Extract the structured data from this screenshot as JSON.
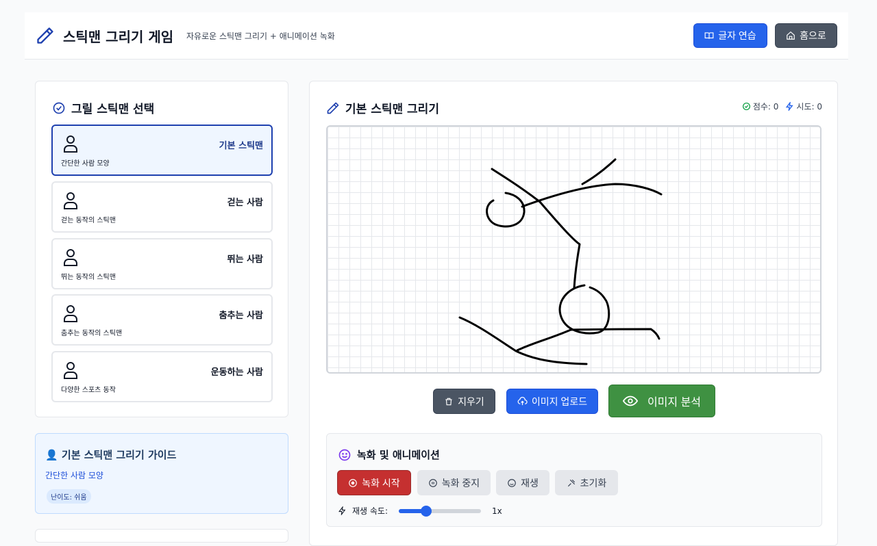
{
  "header": {
    "title": "스틱맨 그리기 게임",
    "subtitle": "자유로운 스틱맨 그리기 + 애니메이션 녹화",
    "practice_button": "글자 연습",
    "home_button": "홈으로"
  },
  "selector": {
    "title": "그릴 스틱맨 선택",
    "items": [
      {
        "name": "기본 스틱맨",
        "desc": "간단한 사람 모양",
        "selected": true
      },
      {
        "name": "걷는 사람",
        "desc": "걷는 동작의 스틱맨",
        "selected": false
      },
      {
        "name": "뛰는 사람",
        "desc": "뛰는 동작의 스틱맨",
        "selected": false
      },
      {
        "name": "춤추는 사람",
        "desc": "춤추는 동작의 스틱맨",
        "selected": false
      },
      {
        "name": "운동하는 사람",
        "desc": "다양한 스포츠 동작",
        "selected": false
      }
    ]
  },
  "guide": {
    "title": "👤 기본 스틱맨 그리기 가이드",
    "desc": "간단한 사람 모양",
    "difficulty": "난이도: 쉬움"
  },
  "main": {
    "title": "기본 스틱맨 그리기",
    "score": "점수: 0",
    "attempts": "시도: 0",
    "clear_button": "지우기",
    "upload_button": "이미지 업로드",
    "analyze_button": "이미지 분석"
  },
  "recording": {
    "title": "녹화 및 애니메이션",
    "start": "녹화 시작",
    "stop": "녹화 중지",
    "play": "재생",
    "reset": "초기화",
    "speed_label": "재생 속도:",
    "speed_value": "1x",
    "speed_level": 0.33
  },
  "colors": {
    "accent": "#2563eb",
    "selected_border": "#1e40af",
    "record": "#c53030",
    "analyze": "#3f9142"
  }
}
